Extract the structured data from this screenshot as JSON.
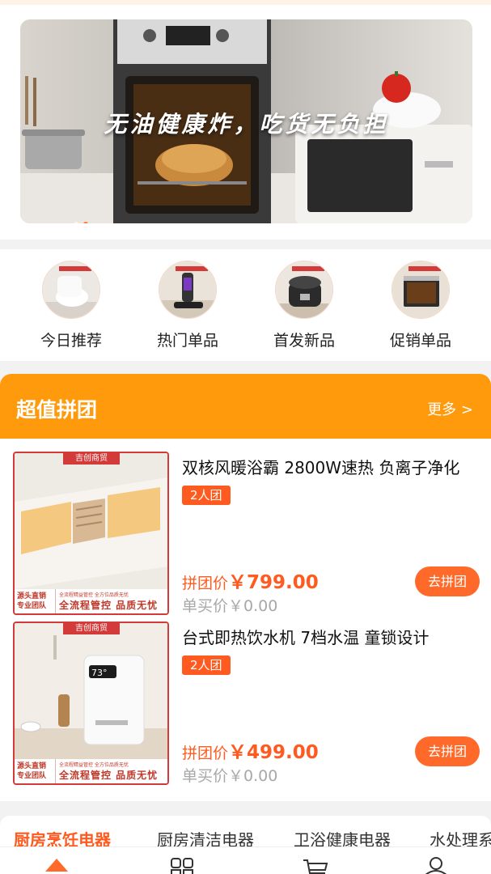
{
  "banner": {
    "headline": "无油健康炸，吃货无负担",
    "dot_count": 2,
    "active_dot": 1
  },
  "categories": [
    {
      "label": "今日推荐",
      "icon": "smart-toilet-icon"
    },
    {
      "label": "热门单品",
      "icon": "vacuum-cleaner-icon"
    },
    {
      "label": "首发新品",
      "icon": "pressure-cooker-icon"
    },
    {
      "label": "促销单品",
      "icon": "built-in-oven-icon"
    }
  ],
  "group_buy": {
    "title": "超值拼团",
    "more_label": "更多 >",
    "items": [
      {
        "title": "双核风暖浴霸 2800W速热 负离子净化",
        "badge": "2人团",
        "price_label": "拼团价",
        "price": "￥799.00",
        "single_label": "单买价",
        "single_price": "￥0.00",
        "button": "去拼团",
        "image_top_tag": "吉创商贸",
        "image_bottom_left": "源头直销\n专业团队",
        "image_bottom_sub": "全流程精益管控 全方位品质无忧",
        "image_bottom_main": "全流程管控 品质无忧",
        "image_icon": "bath-heater-icon"
      },
      {
        "title": "台式即热饮水机 7档水温 童锁设计",
        "badge": "2人团",
        "price_label": "拼团价",
        "price": "￥499.00",
        "single_label": "单买价",
        "single_price": "￥0.00",
        "button": "去拼团",
        "image_top_tag": "吉创商贸",
        "image_bottom_left": "源头直销\n专业团队",
        "image_bottom_sub": "全流程精益管控 全方位品质无忧",
        "image_bottom_main": "全流程管控 品质无忧",
        "image_icon": "water-dispenser-icon",
        "display_reading": "73°"
      }
    ]
  },
  "tabs": [
    {
      "label": "厨房烹饪电器",
      "active": true
    },
    {
      "label": "厨房清洁电器",
      "active": false
    },
    {
      "label": "卫浴健康电器",
      "active": false
    },
    {
      "label": "水处理系",
      "active": false
    }
  ],
  "bottom_nav": [
    {
      "icon": "home-icon",
      "active": true
    },
    {
      "icon": "category-grid-icon",
      "active": false
    },
    {
      "icon": "cart-icon",
      "active": false
    },
    {
      "icon": "user-icon",
      "active": false
    }
  ],
  "colors": {
    "accent": "#ff5a1f",
    "header_orange": "#ff9a0c",
    "button_orange": "#ff6a2a",
    "badge_red": "#d33b3b"
  }
}
